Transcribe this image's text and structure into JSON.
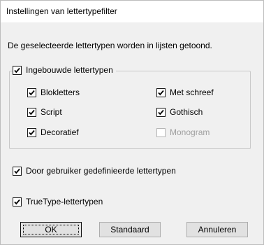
{
  "title": "Instellingen van lettertypefilter",
  "description": "De geselecteerde lettertypen worden in lijsten getoond.",
  "builtin": {
    "label": "Ingebouwde lettertypen",
    "checked": true,
    "options": [
      {
        "label": "Blokletters",
        "checked": true,
        "enabled": true
      },
      {
        "label": "Met schreef",
        "checked": true,
        "enabled": true
      },
      {
        "label": "Script",
        "checked": true,
        "enabled": true
      },
      {
        "label": "Gothisch",
        "checked": true,
        "enabled": true
      },
      {
        "label": "Decoratief",
        "checked": true,
        "enabled": true
      },
      {
        "label": "Monogram",
        "checked": false,
        "enabled": false
      }
    ]
  },
  "user_defined": {
    "label": "Door gebruiker gedefinieerde lettertypen",
    "checked": true
  },
  "truetype": {
    "label": "TrueType-lettertypen",
    "checked": true
  },
  "buttons": {
    "ok": "OK",
    "standard": "Standaard",
    "cancel": "Annuleren"
  }
}
